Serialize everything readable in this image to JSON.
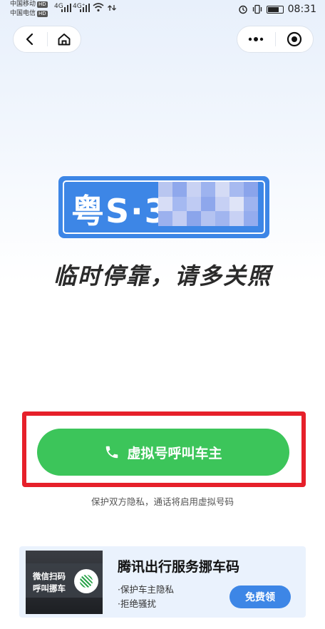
{
  "status_bar": {
    "carrier1": "中国移动",
    "carrier2": "中国电信",
    "hd": "HD",
    "net1": "4G",
    "net2": "4G⁺",
    "time": "08:31"
  },
  "plate": {
    "text": "粤S·3",
    "bg_color": "#3d86e6"
  },
  "slogan": "临时停靠，请多关照",
  "call_button": {
    "label": "虚拟号呼叫车主",
    "color": "#3cc55a",
    "icon": "phone-icon"
  },
  "privacy_note": "保护双方隐私，通话将启用虚拟号码",
  "promo": {
    "image_line1": "微信扫码",
    "image_line2": "呼叫挪车",
    "title": "腾讯出行服务挪车码",
    "feature1": "·保护车主隐私",
    "feature2": "·拒绝骚扰",
    "button": "免费领"
  },
  "highlight_color": "#e6202a"
}
